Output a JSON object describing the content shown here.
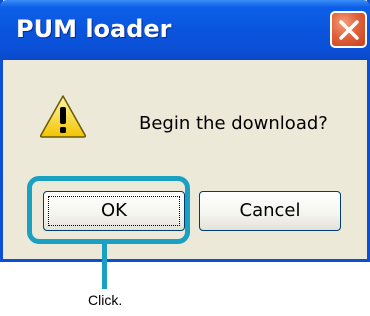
{
  "dialog": {
    "title": "PUM loader",
    "message": "Begin the download?",
    "icon": "warning-icon",
    "close_icon": "close-icon"
  },
  "buttons": {
    "ok_label": "OK",
    "cancel_label": "Cancel"
  },
  "callout": {
    "text": "Click."
  },
  "colors": {
    "titlebar": "#0a55de",
    "dialog_background": "#ece9d8",
    "close_button": "#e2623c",
    "highlight": "#1aa0c2"
  }
}
